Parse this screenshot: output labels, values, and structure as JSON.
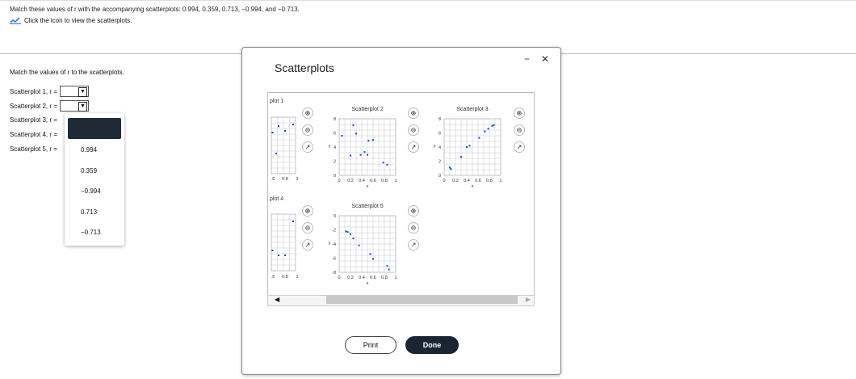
{
  "question": {
    "instruction": "Match these values of r with the accompanying scatterplots: 0.994, 0.359, 0.713, −0.994, and −0.713.",
    "click_icon_text": "Click the icon to view the scatterplots."
  },
  "matching": {
    "label": "Match the values of r to the scatterplots.",
    "rows": [
      {
        "label": "Scatterplot 1, r ="
      },
      {
        "label": "Scatterplot 2, r ="
      },
      {
        "label": "Scatterplot 3, r ="
      },
      {
        "label": "Scatterplot 4, r ="
      },
      {
        "label": "Scatterplot 5, r ="
      }
    ],
    "dropdown_options": [
      "0.994",
      "0.359",
      "−0.994",
      "0.713",
      "−0.713"
    ]
  },
  "modal": {
    "title": "Scatterplots",
    "minimize": "−",
    "close": "✕",
    "print_label": "Print",
    "done_label": "Done"
  },
  "plots": {
    "p1": {
      "title": "plot 1",
      "x_ticks": [
        ".6",
        "0.8",
        "1"
      ]
    },
    "p2": {
      "title": "Scatterplot 2",
      "xlabel": "x",
      "ylabel": "y",
      "y_ticks": [
        "0",
        "2",
        "4",
        "6",
        "8"
      ],
      "x_ticks": [
        "0",
        "0.2",
        "0.4",
        "0.6",
        "0.8",
        "1"
      ],
      "points": [
        [
          0.05,
          5.6
        ],
        [
          0.2,
          2.8
        ],
        [
          0.25,
          7.1
        ],
        [
          0.3,
          5.9
        ],
        [
          0.38,
          2.9
        ],
        [
          0.45,
          3.3
        ],
        [
          0.5,
          2.9
        ],
        [
          0.52,
          4.9
        ],
        [
          0.6,
          5.0
        ],
        [
          0.78,
          1.8
        ],
        [
          0.85,
          1.5
        ]
      ]
    },
    "p3": {
      "title": "Scatterplot 3",
      "xlabel": "x",
      "ylabel": "y",
      "y_ticks": [
        "0",
        "2",
        "4",
        "6",
        "8"
      ],
      "x_ticks": [
        "0",
        "0.2",
        "0.4",
        "0.6",
        "0.8",
        "1"
      ],
      "points": [
        [
          0.1,
          1.1
        ],
        [
          0.12,
          0.9
        ],
        [
          0.3,
          2.6
        ],
        [
          0.4,
          4.0
        ],
        [
          0.45,
          4.2
        ],
        [
          0.62,
          5.3
        ],
        [
          0.72,
          6.2
        ],
        [
          0.78,
          6.6
        ],
        [
          0.85,
          7.0
        ],
        [
          0.88,
          7.1
        ]
      ]
    },
    "p4": {
      "title": "plot 4",
      "x_ticks": [
        ".6",
        "0.8",
        "1"
      ]
    },
    "p5": {
      "title": "Scatterplot 5",
      "xlabel": "x",
      "ylabel": "y",
      "y_ticks": [
        "0",
        "-2",
        "-4",
        "-6",
        "-8"
      ],
      "x_ticks": [
        "0",
        "0.2",
        "0.4",
        "0.6",
        "0.8",
        "1"
      ],
      "points": [
        [
          0.12,
          -2.2
        ],
        [
          0.15,
          -2.3
        ],
        [
          0.2,
          -2.6
        ],
        [
          0.25,
          -3.2
        ],
        [
          0.35,
          -4.2
        ],
        [
          0.55,
          -5.4
        ],
        [
          0.6,
          -6.1
        ],
        [
          0.85,
          -7.1
        ],
        [
          0.88,
          -7.6
        ]
      ]
    }
  },
  "colors": {
    "point": "#1f3fd8",
    "done_bg": "#1b2532",
    "grid": "#c8c8c8"
  }
}
